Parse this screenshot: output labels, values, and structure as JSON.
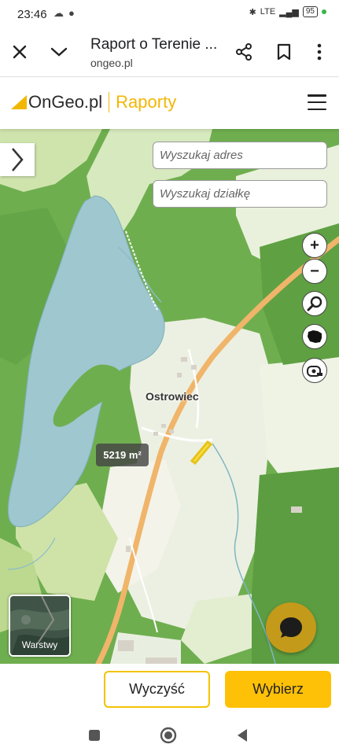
{
  "statusbar": {
    "time": "23:46",
    "network": "LTE",
    "battery": "95"
  },
  "browser": {
    "title": "Raport o Terenie ...",
    "url": "ongeo.pl"
  },
  "site": {
    "brand": "OnGeo.pl",
    "section": "Raporty"
  },
  "map": {
    "search_address_placeholder": "Wyszukaj adres",
    "search_parcel_placeholder": "Wyszukaj działkę",
    "place_label": "Ostrowiec",
    "area_label": "5219 m²",
    "layers_label": "Warstwy"
  },
  "actions": {
    "clear_label": "Wyczyść",
    "choose_label": "Wybierz"
  },
  "colors": {
    "accent": "#ffc107",
    "forest": "#6fae4f",
    "water": "#9fc7cf",
    "road": "#f0b56a"
  },
  "icons": [
    "close-icon",
    "chevron-down-icon",
    "share-icon",
    "bookmark-icon",
    "more-vert-icon",
    "menu-icon",
    "chevron-right-icon",
    "zoom-in-icon",
    "zoom-out-icon",
    "search-icon",
    "poland-map-icon",
    "measure-tape-icon",
    "chat-icon",
    "recent-apps-icon",
    "home-icon",
    "back-icon"
  ]
}
